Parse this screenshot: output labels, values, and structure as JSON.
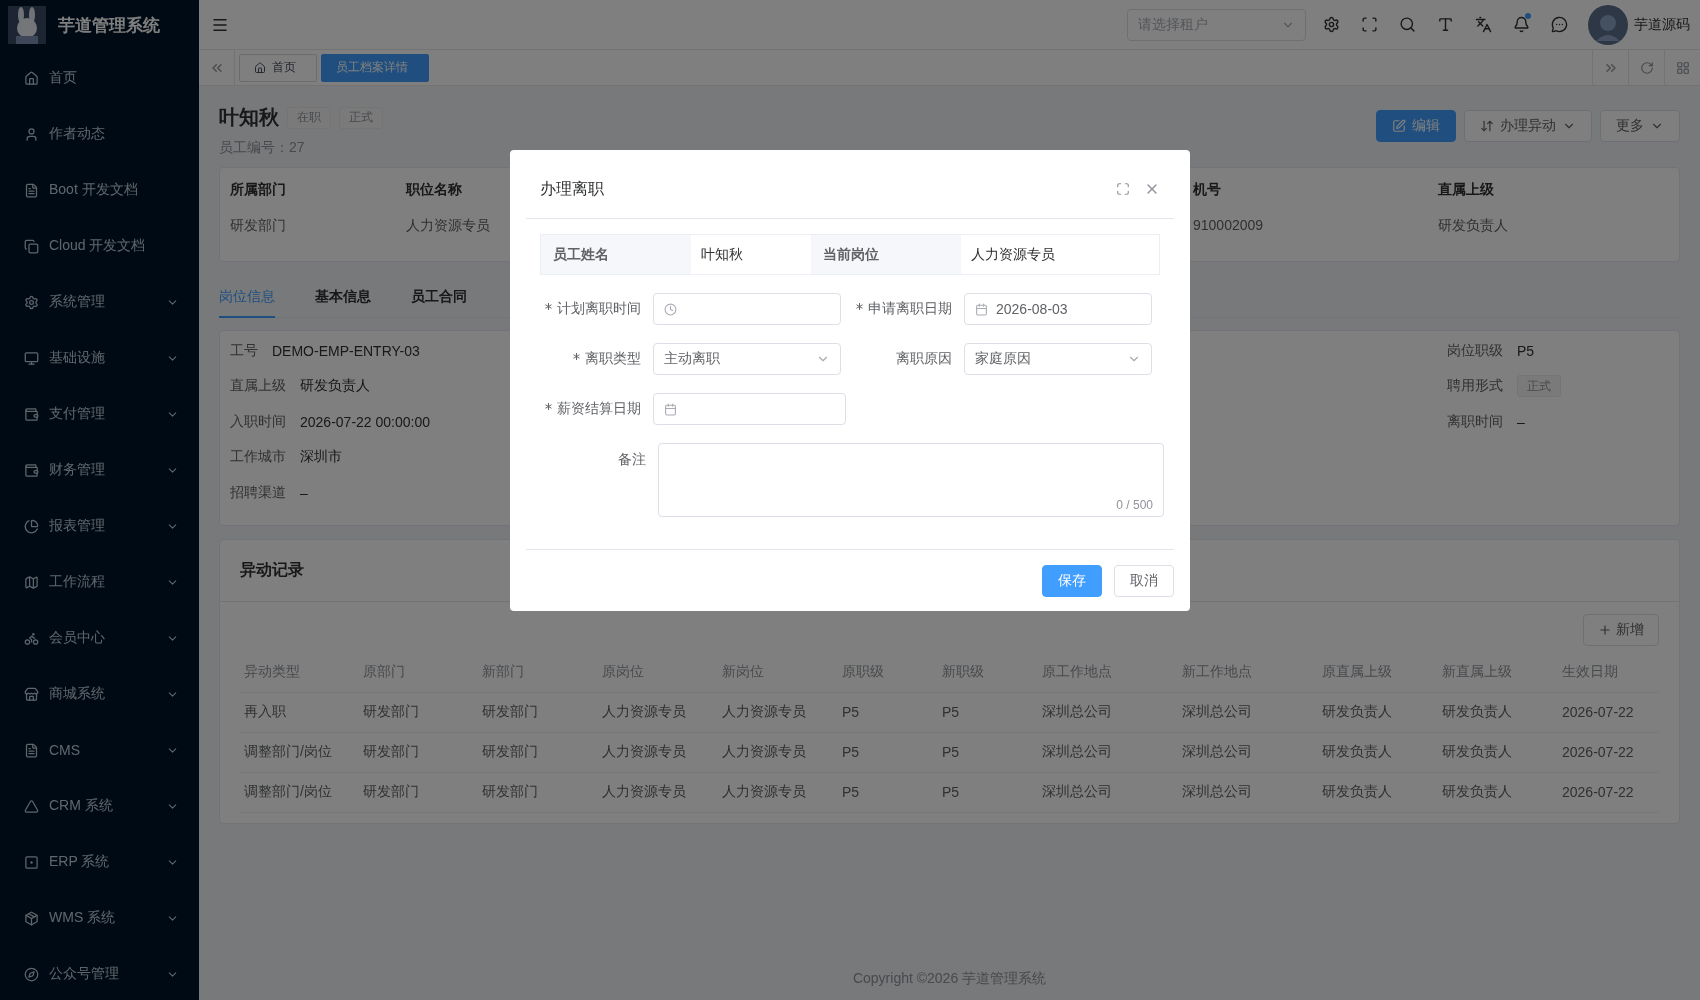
{
  "app": {
    "title": "芋道管理系统"
  },
  "sidebar": {
    "items": [
      {
        "label": "首页",
        "expandable": false
      },
      {
        "label": "作者动态",
        "expandable": false
      },
      {
        "label": "Boot 开发文档",
        "expandable": false
      },
      {
        "label": "Cloud 开发文档",
        "expandable": false
      },
      {
        "label": "系统管理",
        "expandable": true
      },
      {
        "label": "基础设施",
        "expandable": true
      },
      {
        "label": "支付管理",
        "expandable": true
      },
      {
        "label": "财务管理",
        "expandable": true
      },
      {
        "label": "报表管理",
        "expandable": true
      },
      {
        "label": "工作流程",
        "expandable": true
      },
      {
        "label": "会员中心",
        "expandable": true
      },
      {
        "label": "商城系统",
        "expandable": true
      },
      {
        "label": "CMS",
        "expandable": true
      },
      {
        "label": "CRM 系统",
        "expandable": true
      },
      {
        "label": "ERP 系统",
        "expandable": true
      },
      {
        "label": "WMS 系统",
        "expandable": true
      },
      {
        "label": "公众号管理",
        "expandable": true
      }
    ]
  },
  "header": {
    "tenant_select": {
      "placeholder": "请选择租户"
    },
    "icons": [
      {
        "kind": "settings",
        "dot": false
      },
      {
        "kind": "fullscreen",
        "dot": false
      },
      {
        "kind": "search",
        "dot": false
      },
      {
        "kind": "font",
        "dot": false
      },
      {
        "kind": "translate",
        "dot": false
      },
      {
        "kind": "bell",
        "dot": true
      },
      {
        "kind": "chat",
        "dot": false
      }
    ],
    "user": {
      "name": "芋道源码"
    }
  },
  "tags_bar": {
    "tags": [
      {
        "label": "首页",
        "home": true,
        "selected": false
      },
      {
        "label": "员工档案详情",
        "home": false,
        "selected": true
      }
    ]
  },
  "employee": {
    "name": "叶知秋",
    "tags": [
      "在职",
      "正式"
    ],
    "number_label": "员工编号：",
    "number": "27",
    "actions": [
      {
        "label": "编辑",
        "kind": "primary"
      },
      {
        "label": "办理异动",
        "kind": "dropdown"
      },
      {
        "label": "更多",
        "kind": "more"
      }
    ]
  },
  "summary": [
    {
      "label": "所属部门",
      "value": "研发部门"
    },
    {
      "label": "职位名称",
      "value": "人力资源专员"
    },
    {
      "label": "机号",
      "value": "910002009"
    },
    {
      "label": "直属上级",
      "value": "研发负责人"
    }
  ],
  "tabs": [
    {
      "label": "岗位信息",
      "selected": true
    },
    {
      "label": "基本信息",
      "selected": false
    },
    {
      "label": "员工合同",
      "selected": false
    }
  ],
  "position_info": {
    "left": [
      {
        "label": "工号",
        "value": "DEMO-EMP-ENTRY-03",
        "kind": "text"
      },
      {
        "label": "直属上级",
        "value": "研发负责人",
        "kind": "text"
      },
      {
        "label": "入职时间",
        "value": "2026-07-22 00:00:00",
        "kind": "text"
      },
      {
        "label": "工作城市",
        "value": "深圳市",
        "kind": "text"
      },
      {
        "label": "招聘渠道",
        "value": "–",
        "kind": "text"
      }
    ],
    "right": [
      {
        "label": "岗位职级",
        "value": "P5",
        "kind": "text"
      },
      {
        "label": "聘用形式",
        "value": "正式",
        "kind": "tag"
      },
      {
        "label": "离职时间",
        "value": "–",
        "kind": "text"
      }
    ]
  },
  "changes": {
    "title": "异动记录",
    "add_button": "新增",
    "columns": [
      "异动类型",
      "原部门",
      "新部门",
      "原岗位",
      "新岗位",
      "原职级",
      "新职级",
      "原工作地点",
      "新工作地点",
      "原直属上级",
      "新直属上级",
      "生效日期"
    ],
    "rows": [
      [
        "再入职",
        "研发部门",
        "研发部门",
        "人力资源专员",
        "人力资源专员",
        "P5",
        "P5",
        "深圳总公司",
        "深圳总公司",
        "研发负责人",
        "研发负责人",
        "2026-07-22"
      ],
      [
        "调整部门/岗位",
        "研发部门",
        "研发部门",
        "人力资源专员",
        "人力资源专员",
        "P5",
        "P5",
        "深圳总公司",
        "深圳总公司",
        "研发负责人",
        "研发负责人",
        "2026-07-22"
      ],
      [
        "调整部门/岗位",
        "研发部门",
        "研发部门",
        "人力资源专员",
        "人力资源专员",
        "P5",
        "P5",
        "深圳总公司",
        "深圳总公司",
        "研发负责人",
        "研发负责人",
        "2026-07-22"
      ]
    ]
  },
  "footer": "Copyright ©2026 芋道管理系统",
  "dialog": {
    "title": "办理离职",
    "info": [
      {
        "label": "员工姓名",
        "value": "叶知秋"
      },
      {
        "label": "当前岗位",
        "value": "人力资源专员"
      }
    ],
    "fields": [
      {
        "label": "计划离职时间",
        "kind": "time",
        "required": true
      },
      {
        "label": "申请离职日期",
        "kind": "date",
        "required": true,
        "value": "2026-08-03"
      },
      {
        "label": "离职类型",
        "kind": "select",
        "required": true,
        "value": "主动离职"
      },
      {
        "label": "离职原因",
        "kind": "select",
        "required": false,
        "value": "家庭原因"
      },
      {
        "label": "薪资结算日期",
        "kind": "date",
        "required": true
      },
      {
        "label": "备注",
        "kind": "textarea",
        "required": false,
        "counter": "0 / 500"
      }
    ],
    "buttons": [
      {
        "label": "保存",
        "kind": "primary"
      },
      {
        "label": "取消",
        "kind": "default"
      }
    ]
  }
}
